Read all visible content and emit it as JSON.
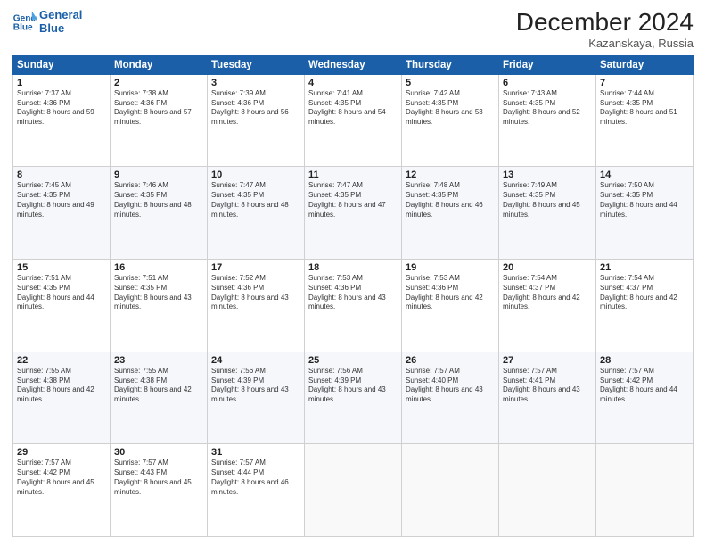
{
  "header": {
    "logo_line1": "General",
    "logo_line2": "Blue",
    "month_title": "December 2024",
    "location": "Kazanskaya, Russia"
  },
  "weekdays": [
    "Sunday",
    "Monday",
    "Tuesday",
    "Wednesday",
    "Thursday",
    "Friday",
    "Saturday"
  ],
  "weeks": [
    [
      {
        "day": "1",
        "sunrise": "7:37 AM",
        "sunset": "4:36 PM",
        "daylight": "8 hours and 59 minutes."
      },
      {
        "day": "2",
        "sunrise": "7:38 AM",
        "sunset": "4:36 PM",
        "daylight": "8 hours and 57 minutes."
      },
      {
        "day": "3",
        "sunrise": "7:39 AM",
        "sunset": "4:36 PM",
        "daylight": "8 hours and 56 minutes."
      },
      {
        "day": "4",
        "sunrise": "7:41 AM",
        "sunset": "4:35 PM",
        "daylight": "8 hours and 54 minutes."
      },
      {
        "day": "5",
        "sunrise": "7:42 AM",
        "sunset": "4:35 PM",
        "daylight": "8 hours and 53 minutes."
      },
      {
        "day": "6",
        "sunrise": "7:43 AM",
        "sunset": "4:35 PM",
        "daylight": "8 hours and 52 minutes."
      },
      {
        "day": "7",
        "sunrise": "7:44 AM",
        "sunset": "4:35 PM",
        "daylight": "8 hours and 51 minutes."
      }
    ],
    [
      {
        "day": "8",
        "sunrise": "7:45 AM",
        "sunset": "4:35 PM",
        "daylight": "8 hours and 49 minutes."
      },
      {
        "day": "9",
        "sunrise": "7:46 AM",
        "sunset": "4:35 PM",
        "daylight": "8 hours and 48 minutes."
      },
      {
        "day": "10",
        "sunrise": "7:47 AM",
        "sunset": "4:35 PM",
        "daylight": "8 hours and 48 minutes."
      },
      {
        "day": "11",
        "sunrise": "7:47 AM",
        "sunset": "4:35 PM",
        "daylight": "8 hours and 47 minutes."
      },
      {
        "day": "12",
        "sunrise": "7:48 AM",
        "sunset": "4:35 PM",
        "daylight": "8 hours and 46 minutes."
      },
      {
        "day": "13",
        "sunrise": "7:49 AM",
        "sunset": "4:35 PM",
        "daylight": "8 hours and 45 minutes."
      },
      {
        "day": "14",
        "sunrise": "7:50 AM",
        "sunset": "4:35 PM",
        "daylight": "8 hours and 44 minutes."
      }
    ],
    [
      {
        "day": "15",
        "sunrise": "7:51 AM",
        "sunset": "4:35 PM",
        "daylight": "8 hours and 44 minutes."
      },
      {
        "day": "16",
        "sunrise": "7:51 AM",
        "sunset": "4:35 PM",
        "daylight": "8 hours and 43 minutes."
      },
      {
        "day": "17",
        "sunrise": "7:52 AM",
        "sunset": "4:36 PM",
        "daylight": "8 hours and 43 minutes."
      },
      {
        "day": "18",
        "sunrise": "7:53 AM",
        "sunset": "4:36 PM",
        "daylight": "8 hours and 43 minutes."
      },
      {
        "day": "19",
        "sunrise": "7:53 AM",
        "sunset": "4:36 PM",
        "daylight": "8 hours and 42 minutes."
      },
      {
        "day": "20",
        "sunrise": "7:54 AM",
        "sunset": "4:37 PM",
        "daylight": "8 hours and 42 minutes."
      },
      {
        "day": "21",
        "sunrise": "7:54 AM",
        "sunset": "4:37 PM",
        "daylight": "8 hours and 42 minutes."
      }
    ],
    [
      {
        "day": "22",
        "sunrise": "7:55 AM",
        "sunset": "4:38 PM",
        "daylight": "8 hours and 42 minutes."
      },
      {
        "day": "23",
        "sunrise": "7:55 AM",
        "sunset": "4:38 PM",
        "daylight": "8 hours and 42 minutes."
      },
      {
        "day": "24",
        "sunrise": "7:56 AM",
        "sunset": "4:39 PM",
        "daylight": "8 hours and 43 minutes."
      },
      {
        "day": "25",
        "sunrise": "7:56 AM",
        "sunset": "4:39 PM",
        "daylight": "8 hours and 43 minutes."
      },
      {
        "day": "26",
        "sunrise": "7:57 AM",
        "sunset": "4:40 PM",
        "daylight": "8 hours and 43 minutes."
      },
      {
        "day": "27",
        "sunrise": "7:57 AM",
        "sunset": "4:41 PM",
        "daylight": "8 hours and 43 minutes."
      },
      {
        "day": "28",
        "sunrise": "7:57 AM",
        "sunset": "4:42 PM",
        "daylight": "8 hours and 44 minutes."
      }
    ],
    [
      {
        "day": "29",
        "sunrise": "7:57 AM",
        "sunset": "4:42 PM",
        "daylight": "8 hours and 45 minutes."
      },
      {
        "day": "30",
        "sunrise": "7:57 AM",
        "sunset": "4:43 PM",
        "daylight": "8 hours and 45 minutes."
      },
      {
        "day": "31",
        "sunrise": "7:57 AM",
        "sunset": "4:44 PM",
        "daylight": "8 hours and 46 minutes."
      },
      null,
      null,
      null,
      null
    ]
  ]
}
